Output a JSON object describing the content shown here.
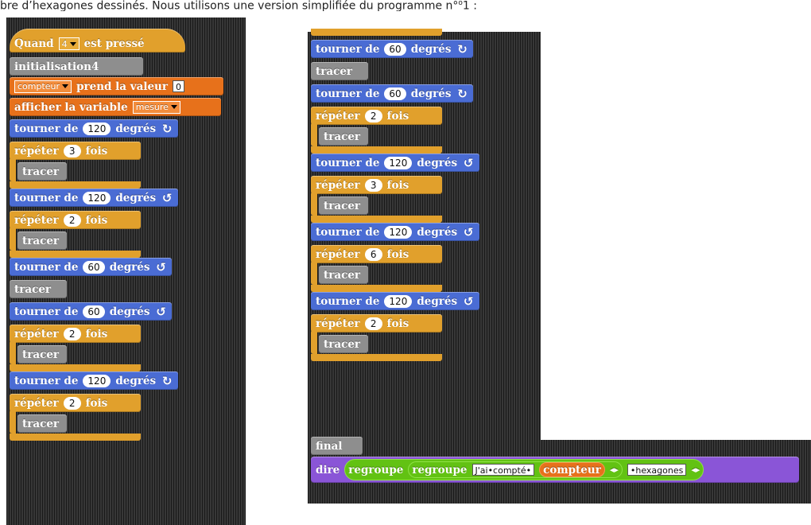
{
  "intro": {
    "text_before": "bre d’hexagones dessinés. Nous utilisons une version simplifiée du programme n°",
    "text_superscript": "o",
    "text_after": "1 :"
  },
  "left": {
    "hat": {
      "label": "Quand",
      "key": "4",
      "suffix": "est pressé"
    },
    "init": "initialisation4",
    "set": {
      "var": "compteur",
      "label": "prend la valeur",
      "value": "0"
    },
    "show": {
      "label": "afficher la variable",
      "var": "mesure"
    },
    "blocks": [
      {
        "type": "turn",
        "label": "tourner de",
        "value": "120",
        "unit": "degrés",
        "dir": "↻"
      },
      {
        "type": "repeat",
        "label": "répéter",
        "value": "3",
        "suffix": "fois",
        "inner": "tracer"
      },
      {
        "type": "turn",
        "label": "tourner de",
        "value": "120",
        "unit": "degrés",
        "dir": "↺"
      },
      {
        "type": "repeat",
        "label": "répéter",
        "value": "2",
        "suffix": "fois",
        "inner": "tracer"
      },
      {
        "type": "turn",
        "label": "tourner de",
        "value": "60",
        "unit": "degrés",
        "dir": "↺"
      },
      {
        "type": "trace",
        "label": "tracer"
      },
      {
        "type": "turn",
        "label": "tourner de",
        "value": "60",
        "unit": "degrés",
        "dir": "↺"
      },
      {
        "type": "repeat",
        "label": "répéter",
        "value": "2",
        "suffix": "fois",
        "inner": "tracer"
      },
      {
        "type": "turn",
        "label": "tourner de",
        "value": "120",
        "unit": "degrés",
        "dir": "↻"
      },
      {
        "type": "repeat",
        "label": "répéter",
        "value": "2",
        "suffix": "fois",
        "inner": "tracer"
      }
    ]
  },
  "right": {
    "blocks": [
      {
        "type": "turn",
        "label": "tourner de",
        "value": "60",
        "unit": "degrés",
        "dir": "↻"
      },
      {
        "type": "trace",
        "label": "tracer"
      },
      {
        "type": "turn",
        "label": "tourner de",
        "value": "60",
        "unit": "degrés",
        "dir": "↻"
      },
      {
        "type": "repeat",
        "label": "répéter",
        "value": "2",
        "suffix": "fois",
        "inner": "tracer"
      },
      {
        "type": "turn",
        "label": "tourner de",
        "value": "120",
        "unit": "degrés",
        "dir": "↺"
      },
      {
        "type": "repeat",
        "label": "répéter",
        "value": "3",
        "suffix": "fois",
        "inner": "tracer"
      },
      {
        "type": "turn",
        "label": "tourner de",
        "value": "120",
        "unit": "degrés",
        "dir": "↺"
      },
      {
        "type": "repeat",
        "label": "répéter",
        "value": "6",
        "suffix": "fois",
        "inner": "tracer"
      },
      {
        "type": "turn",
        "label": "tourner de",
        "value": "120",
        "unit": "degrés",
        "dir": "↺"
      },
      {
        "type": "repeat",
        "label": "répéter",
        "value": "2",
        "suffix": "fois",
        "inner": "tracer"
      }
    ],
    "final": "final",
    "say": {
      "label": "dire",
      "join_outer": "regroupe",
      "join_inner": "regroupe",
      "text1": "J'ai•compté•",
      "var": "compteur",
      "text2": "•hexagones"
    }
  },
  "colors": {
    "motion": "#4a6cd4",
    "control": "#e1a02c",
    "variables": "#e7711b",
    "custom": "#8e8e8e",
    "looks": "#8a55d7",
    "operators": "#62c213"
  }
}
